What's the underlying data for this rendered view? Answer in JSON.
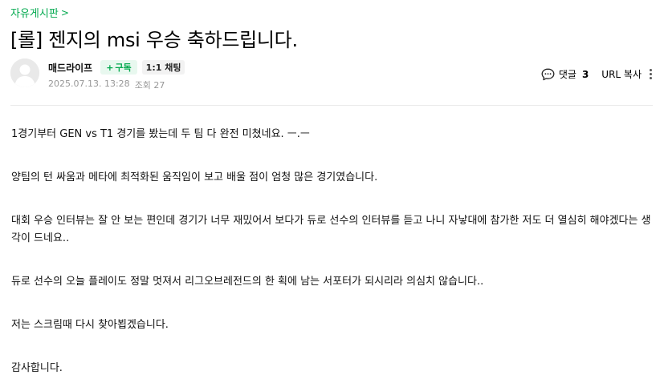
{
  "board": {
    "label": "자유게시판",
    "chevron": ">"
  },
  "post": {
    "title": "[롤] 젠지의 msi 우승 축하드립니다."
  },
  "author": {
    "name": "매드라이프",
    "subscribe_label": "구독",
    "subscribe_prefix": "+",
    "chat_label": "1:1 채팅"
  },
  "meta": {
    "date": "2025.07.13. 13:28",
    "views_label": "조회 27"
  },
  "tools": {
    "comment_label": "댓글",
    "comment_count": "3",
    "url_copy_label": "URL 복사"
  },
  "body": {
    "paragraphs": [
      "1경기부터 GEN vs T1 경기를 봤는데 두 팀 다 완전 미쳤네요. ㅡ.ㅡ",
      "양팀의 턴 싸움과 메타에 최적화된 움직임이 보고 배울 점이 엄청 많은 경기였습니다.",
      "대회 우승 인터뷰는 잘 안 보는 편인데 경기가 너무 재밌어서 보다가 듀로 선수의 인터뷰를 듣고 나니 자낳대에 참가한 저도 더 열심히 해야겠다는 생각이 드네요..",
      "듀로 선수의 오늘 플레이도 정말 멋져서 리그오브레전드의 한 획에 남는 서포터가 되시리라 의심치 않습니다..",
      "저는 스크림때 다시 찾아뵙겠습니다.",
      "감사합니다."
    ]
  },
  "colors": {
    "accent": "#03a94f",
    "meta": "#979797"
  }
}
